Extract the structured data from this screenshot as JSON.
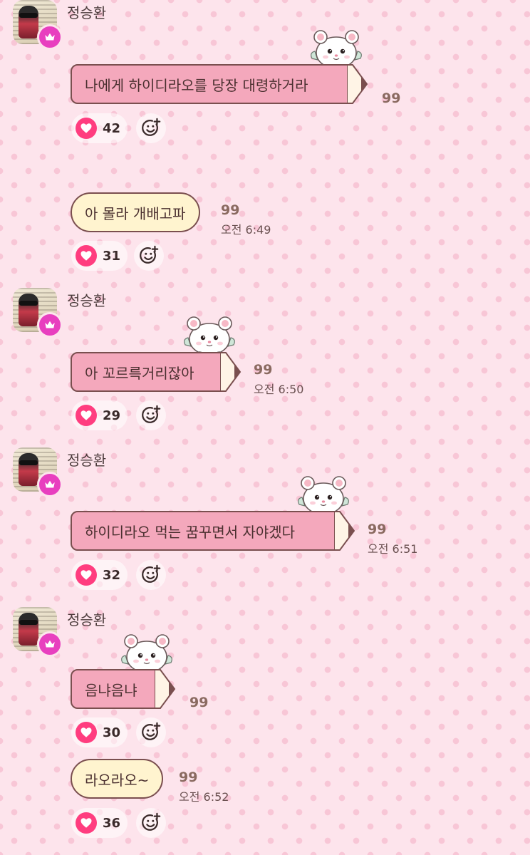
{
  "messages": [
    {
      "sender": "정승환",
      "text": "나에게 하이디라오를 당장 대령하거라",
      "read_count": "99",
      "time": "",
      "likes": "42"
    },
    {
      "text": "아 몰라 개배고파",
      "read_count": "99",
      "time": "오전 6:49",
      "likes": "31"
    },
    {
      "sender": "정승환",
      "text": "아 꼬르륵거리잖아",
      "read_count": "99",
      "time": "오전 6:50",
      "likes": "29"
    },
    {
      "sender": "정승환",
      "text": "하이디라오 먹는 꿈꾸면서 자야겠다",
      "read_count": "99",
      "time": "오전 6:51",
      "likes": "32"
    },
    {
      "sender": "정승환",
      "text": "음냐음냐",
      "read_count": "99",
      "time": "",
      "likes": "30"
    },
    {
      "text": "라오라오~",
      "read_count": "99",
      "time": "오전 6:52",
      "likes": "36"
    }
  ],
  "colors": {
    "background": "#fde4ec",
    "pencil_bubble": "#f4a8bc",
    "plain_bubble": "#fff4cf",
    "heart": "#ff3d7f",
    "crown_badge": "#e83fbf"
  },
  "icons": {
    "badge": "crown-icon",
    "like": "heart-icon",
    "reaction": "add-emoji-icon",
    "decoration": "hamster-sticker"
  }
}
